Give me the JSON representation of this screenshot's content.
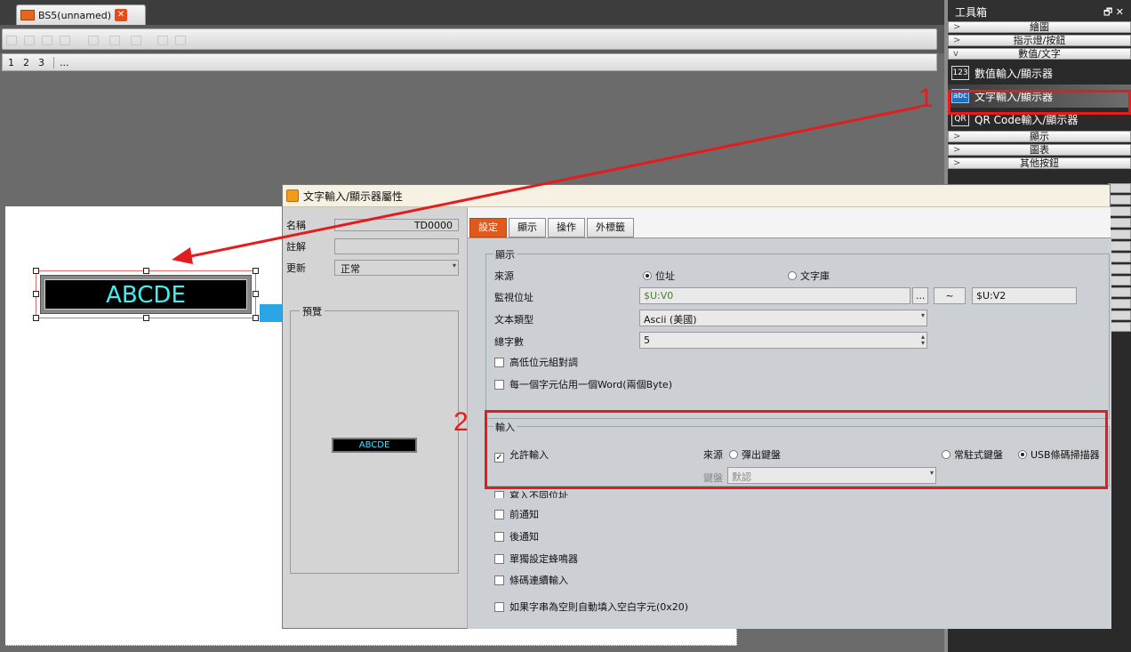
{
  "editor": {
    "tab_title": "BS5(unnamed)",
    "close_glyph": "✕",
    "pages": [
      "1",
      "2",
      "3"
    ],
    "more_pages": "..."
  },
  "canvas": {
    "widget_text": "ABCDE"
  },
  "toolbox": {
    "title": "工具箱",
    "window_controls": "🗗 ✕",
    "categories_top": [
      "繪圖",
      "指示燈/按鈕",
      "數值/文字"
    ],
    "tools": [
      {
        "icon": "123",
        "label": "數值輸入/顯示器"
      },
      {
        "icon": "abc",
        "label": "文字輸入/顯示器"
      },
      {
        "icon": "QR",
        "label": "QR Code輸入/顯示器"
      }
    ],
    "categories_bottom": [
      "顯示",
      "圖表",
      "其他按鈕"
    ]
  },
  "dialog": {
    "title": "文字輸入/顯示器屬性",
    "name_label": "名稱",
    "name_value": "TD0000",
    "comment_label": "註解",
    "comment_value": "",
    "update_label": "更新",
    "update_value": "正常",
    "preview_label": "預覽",
    "preview_text": "ABCDE",
    "tabs": [
      "設定",
      "顯示",
      "操作",
      "外標籤"
    ],
    "display_group": {
      "title": "顯示",
      "source_label": "來源",
      "source_options": [
        "位址",
        "文字庫"
      ],
      "source_selected": "位址",
      "monitor_label": "監視位址",
      "monitor_value": "$U:V0",
      "monitor_btn": "...",
      "range_sep": "~",
      "monitor_end": "$U:V2",
      "text_type_label": "文本類型",
      "text_type_value": "Ascii (美國)",
      "char_count_label": "總字數",
      "char_count_value": "5",
      "swap_label": "高低位元組對調",
      "word_label": "每一個字元佔用一個Word(兩個Byte)"
    },
    "input_group": {
      "title": "輸入",
      "allow_input_label": "允許輸入",
      "allow_input_checked": true,
      "source_label": "來源",
      "source_options": [
        "彈出鍵盤",
        "常駐式鍵盤",
        "USB條碼掃描器"
      ],
      "source_selected": "USB條碼掃描器",
      "keyboard_label": "鍵盤",
      "keyboard_value": "默認"
    },
    "more_options": [
      "寫入不同位址",
      "前通知",
      "後通知",
      "單獨設定蜂鳴器",
      "條碼連續輸入"
    ],
    "partial_option": "寫入不同位址",
    "last_option": "如果字串為空則自動填入空白字元(0x20)"
  },
  "annotations": {
    "label_1": "1",
    "label_2": "2",
    "color": "#e31d1d",
    "arrow_color": "#29a6e3"
  }
}
